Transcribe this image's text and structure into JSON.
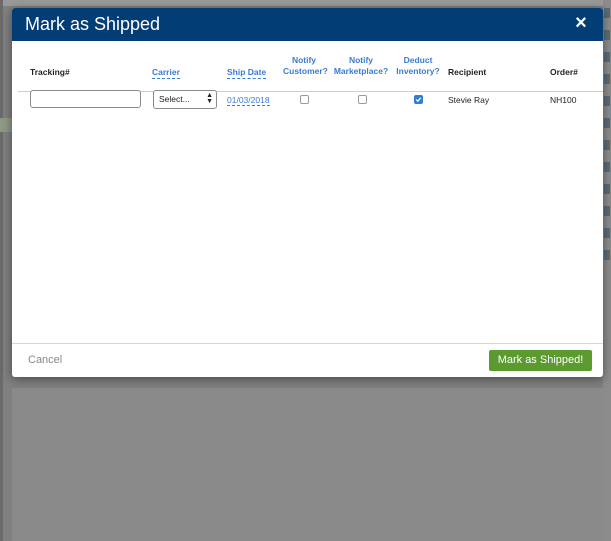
{
  "modal": {
    "title": "Mark as Shipped",
    "close_icon": "×"
  },
  "table": {
    "headers": {
      "tracking": "Tracking#",
      "carrier": "Carrier",
      "ship_date": "Ship Date",
      "notify_customer_1": "Notify",
      "notify_customer_2": "Customer?",
      "notify_marketplace_1": "Notify",
      "notify_marketplace_2": "Marketplace?",
      "deduct_inventory_1": "Deduct",
      "deduct_inventory_2": "Inventory?",
      "recipient": "Recipient",
      "order": "Order#"
    },
    "row": {
      "tracking_value": "",
      "carrier_selected": "Select...",
      "ship_date": "01/03/2018",
      "notify_customer": false,
      "notify_marketplace": false,
      "deduct_inventory": true,
      "recipient": "Stevie Ray",
      "order": "NH100"
    }
  },
  "footer": {
    "cancel_label": "Cancel",
    "submit_label": "Mark as Shipped!"
  },
  "colors": {
    "header_bg": "#033d75",
    "accent_blue": "#3a7bd5",
    "submit_green": "#5b9a2e"
  }
}
